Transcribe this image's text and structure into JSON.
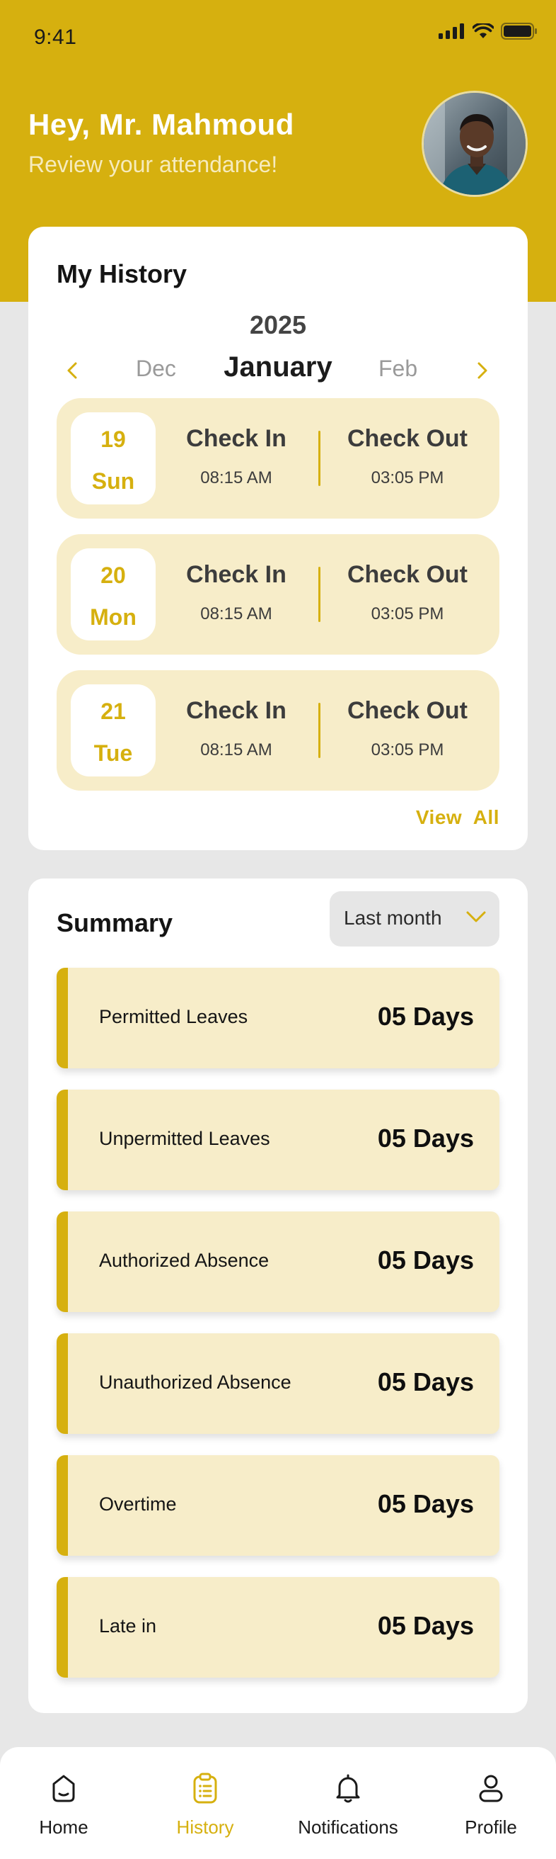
{
  "status_bar": {
    "time": "9:41"
  },
  "header": {
    "greeting": "Hey, Mr. Mahmoud",
    "subtitle": "Review your attendance!",
    "brand_color": "#D6B00F"
  },
  "history": {
    "title": "My History",
    "year": "2025",
    "prev_month": "Dec",
    "current_month": "January",
    "next_month": "Feb",
    "days": [
      {
        "num": "19",
        "name": "Sun",
        "check_in_label": "Check In",
        "check_in_time": "08:15 AM",
        "check_out_label": "Check Out",
        "check_out_time": "03:05 PM"
      },
      {
        "num": "20",
        "name": "Mon",
        "check_in_label": "Check In",
        "check_in_time": "08:15 AM",
        "check_out_label": "Check Out",
        "check_out_time": "03:05 PM"
      },
      {
        "num": "21",
        "name": "Tue",
        "check_in_label": "Check In",
        "check_in_time": "08:15 AM",
        "check_out_label": "Check Out",
        "check_out_time": "03:05 PM"
      }
    ],
    "view_all": "View  All"
  },
  "summary": {
    "title": "Summary",
    "filter": "Last month",
    "items": [
      {
        "label": "Permitted Leaves",
        "value": "05 Days"
      },
      {
        "label": "Unpermitted Leaves",
        "value": "05 Days"
      },
      {
        "label": "Authorized Absence",
        "value": "05 Days"
      },
      {
        "label": "Unauthorized Absence",
        "value": "05 Days"
      },
      {
        "label": "Overtime",
        "value": "05 Days"
      },
      {
        "label": "Late in",
        "value": "05 Days"
      }
    ]
  },
  "nav": {
    "items": [
      {
        "label": "Home",
        "icon": "home-icon",
        "active": false
      },
      {
        "label": "History",
        "icon": "clipboard-icon",
        "active": true
      },
      {
        "label": "Notifications",
        "icon": "bell-icon",
        "active": false
      },
      {
        "label": "Profile",
        "icon": "user-icon",
        "active": false
      }
    ]
  }
}
